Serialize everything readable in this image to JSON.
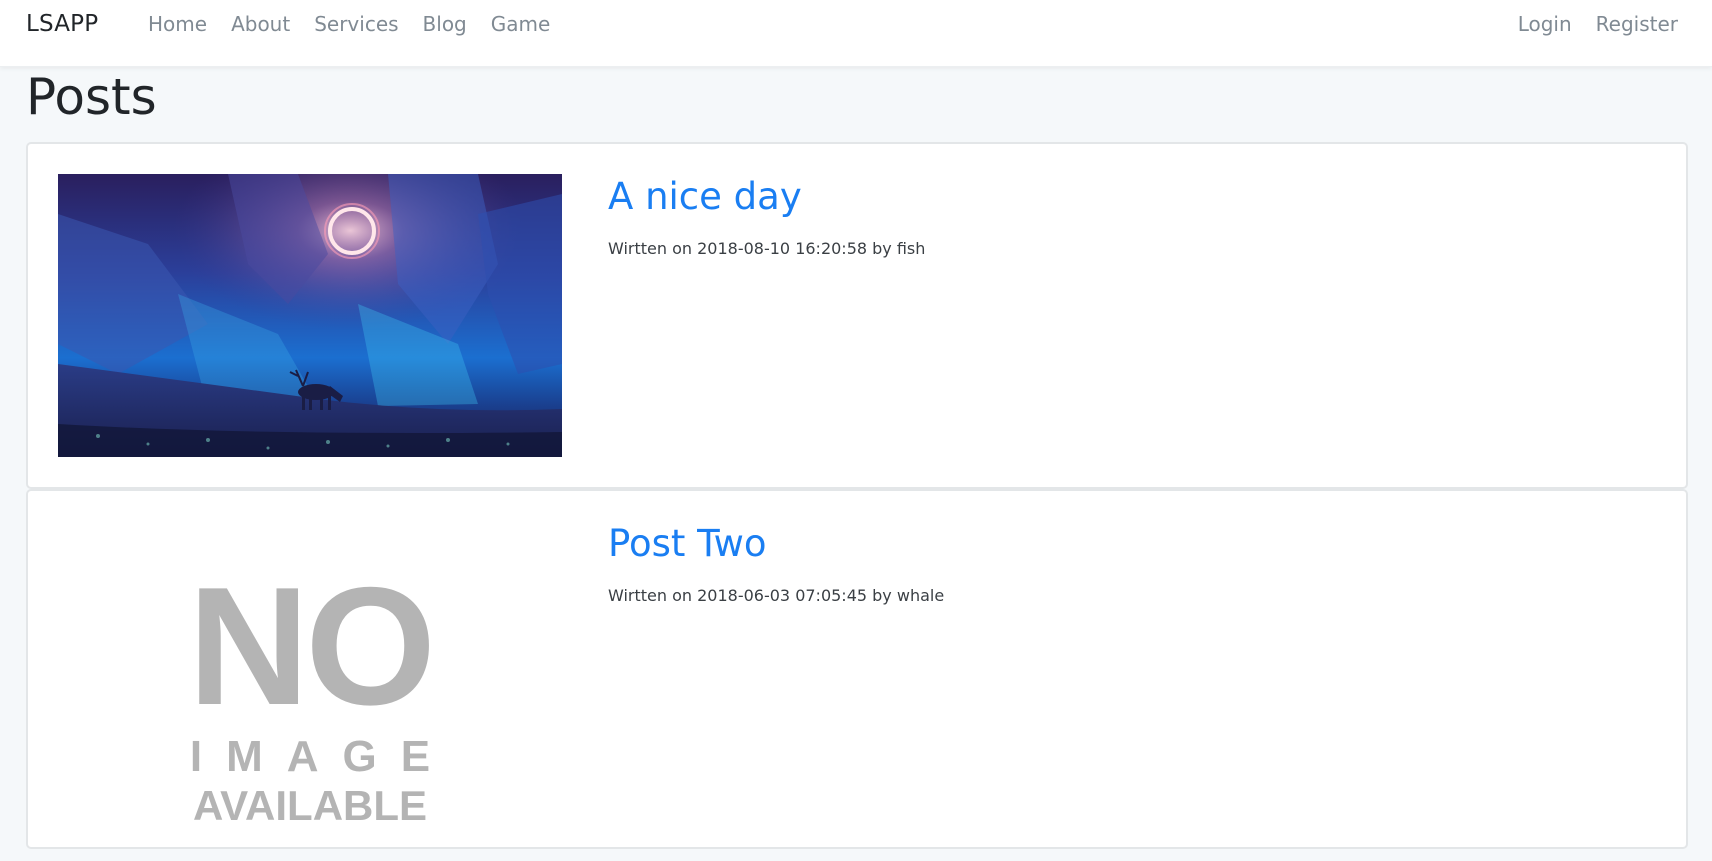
{
  "navbar": {
    "brand": "LSAPP",
    "left_links": [
      "Home",
      "About",
      "Services",
      "Blog",
      "Game"
    ],
    "right_links": [
      "Login",
      "Register"
    ]
  },
  "page": {
    "title": "Posts"
  },
  "posts": [
    {
      "title": "A nice day",
      "meta": "Wirtten on 2018-08-10 16:20:58 by fish",
      "image": "night-sky-deer-landscape"
    },
    {
      "title": "Post Two",
      "meta": "Wirtten on 2018-06-03 07:05:45 by whale",
      "image": "no-image-placeholder",
      "placeholder": {
        "line1": "NO",
        "line2": "IMAGE",
        "line3": "AVAILABLE"
      }
    }
  ],
  "colors": {
    "link": "#1a7ef2",
    "nav_text": "#808a93",
    "background": "#f5f8fa"
  }
}
